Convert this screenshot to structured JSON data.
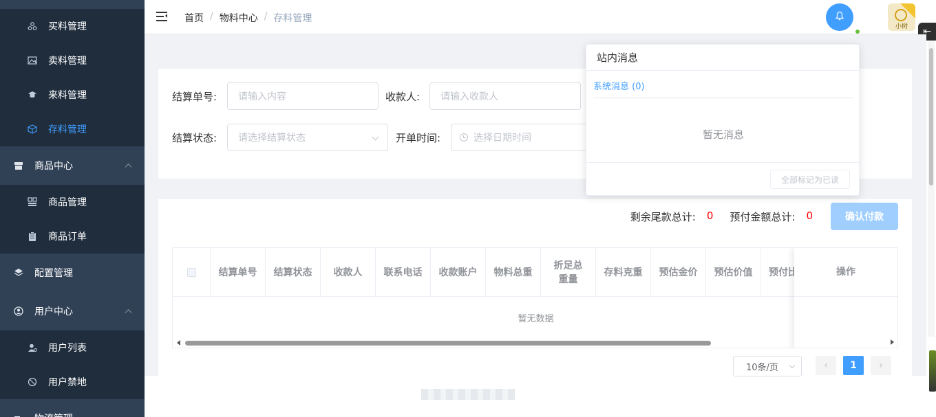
{
  "sidebar": {
    "items": [
      {
        "label": "买料管理",
        "icon": "users-icon"
      },
      {
        "label": "卖料管理",
        "icon": "image-icon"
      },
      {
        "label": "来料管理",
        "icon": "mortarboard-icon"
      },
      {
        "label": "存料管理",
        "icon": "cube-icon",
        "active": true
      },
      {
        "label": "商品中心",
        "icon": "store-icon"
      },
      {
        "label": "商品管理",
        "icon": "grid-icon"
      },
      {
        "label": "商品订单",
        "icon": "clipboard-icon"
      },
      {
        "label": "配置管理",
        "icon": "layers-icon"
      },
      {
        "label": "用户中心",
        "icon": "user-circle-icon"
      },
      {
        "label": "用户列表",
        "icon": "user-icon"
      },
      {
        "label": "用户禁地",
        "icon": "ban-icon"
      },
      {
        "label": "物流管理",
        "icon": "truck-icon"
      }
    ]
  },
  "header": {
    "breadcrumb": [
      "首页",
      "物料中心",
      "存料管理"
    ],
    "avatar_text": "小树",
    "accent": "#409eff"
  },
  "search": {
    "settlement_no_label": "结算单号:",
    "settlement_no_placeholder": "请输入内容",
    "payee_label": "收款人:",
    "payee_placeholder": "请输入收款人",
    "status_label": "结算状态:",
    "status_placeholder": "请选择结算状态",
    "open_time_label": "开单时间:",
    "open_time_placeholder": "选择日期时间"
  },
  "totals": {
    "remaining_label": "剩余尾款总计:",
    "remaining_value": "0",
    "prepaid_label": "预付金额总计:",
    "prepaid_value": "0",
    "confirm_label": "确认付款"
  },
  "table": {
    "columns": [
      "结算单号",
      "结算状态",
      "收款人",
      "联系电话",
      "收款账户",
      "物料总重",
      "折足总重量",
      "存料克重",
      "预估金价",
      "预估价值",
      "预付比"
    ],
    "operation_label": "操作",
    "empty_text": "暂无数据"
  },
  "pagination": {
    "page_size": "10条/页",
    "current_page": "1"
  },
  "notifications": {
    "title": "站内消息",
    "tab_label": "系统消息 (0)",
    "empty_text": "暂无消息",
    "mark_all_label": "全部标记为已读"
  }
}
